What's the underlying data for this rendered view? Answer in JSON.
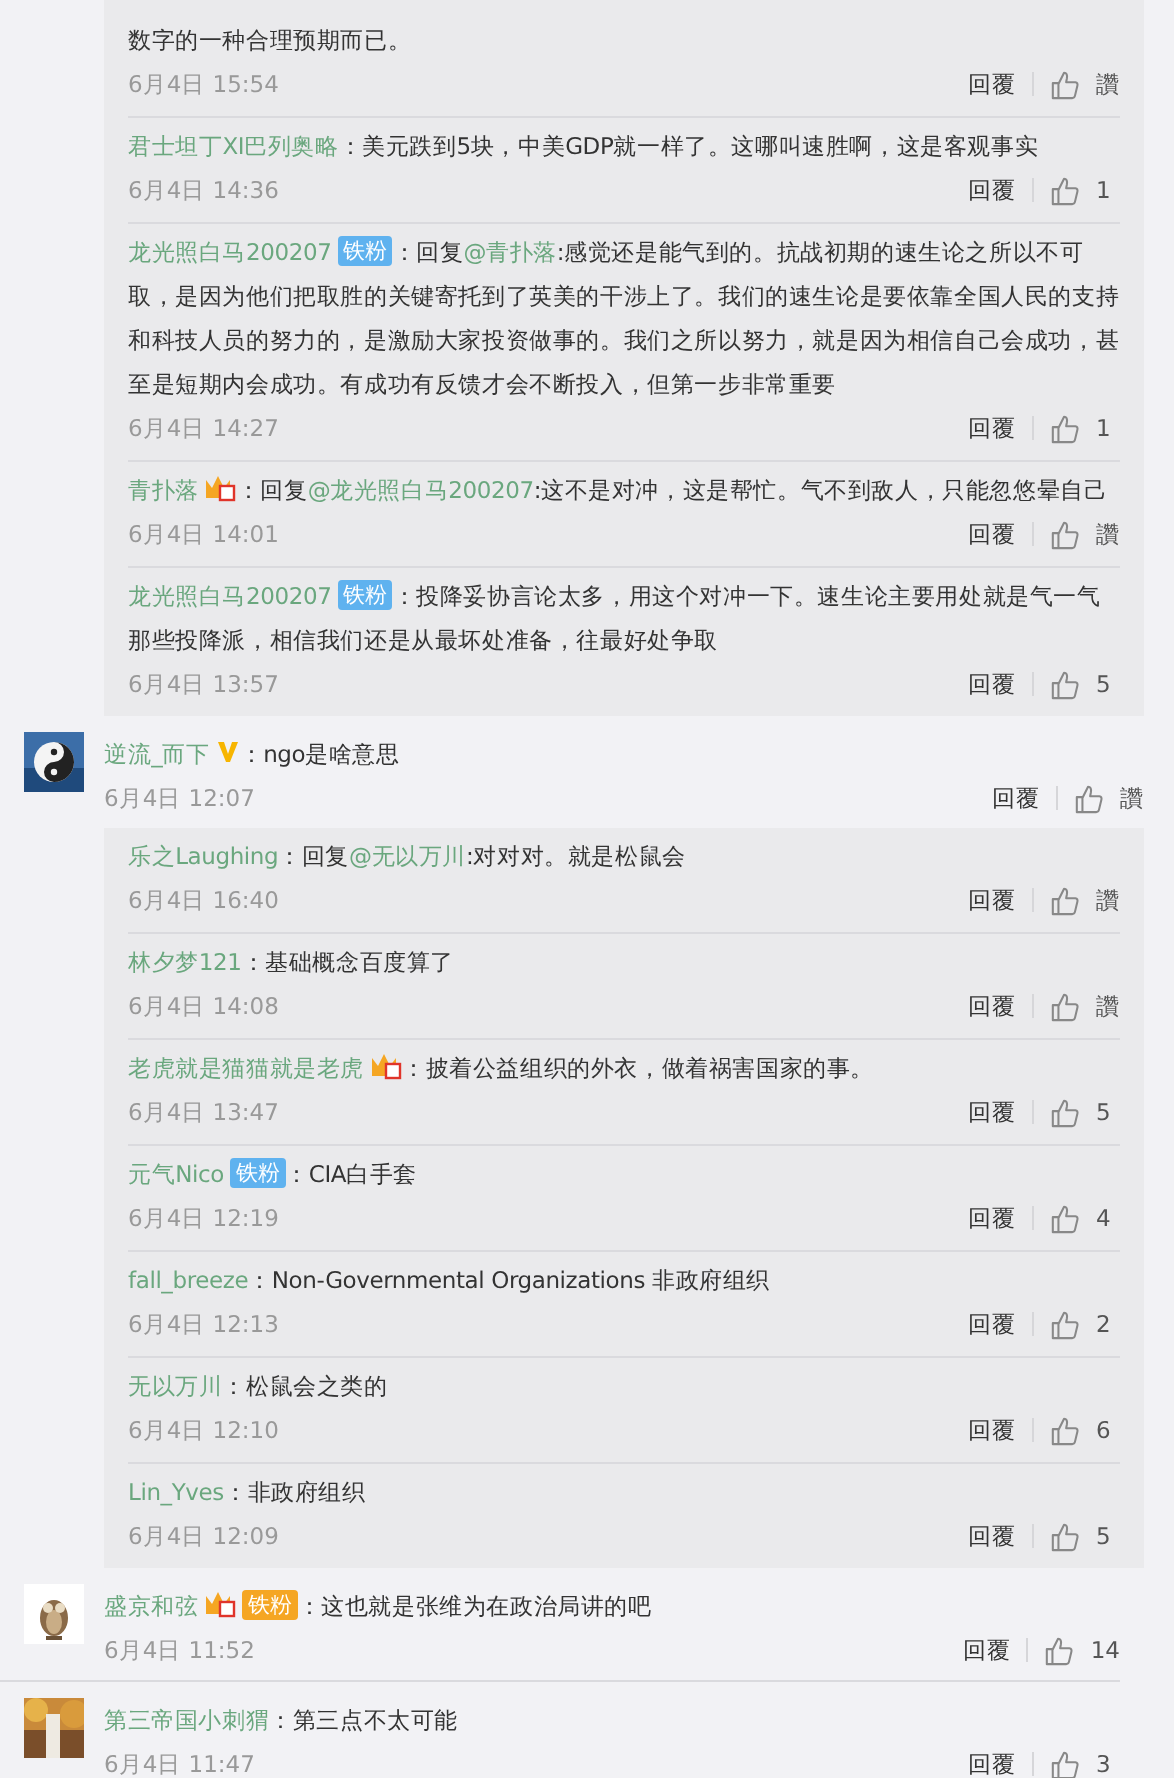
{
  "threads": [
    {
      "kind": "continuation",
      "replies": [
        {
          "body": [
            {
              "text": "数字的一种合理预期而已。"
            }
          ],
          "time": "6月4日 15:54",
          "reply": "回覆",
          "likes": "讚"
        },
        {
          "user": "君士坦丁XI巴列奥略",
          "body": [
            {
              "text": "：美元跌到5块，中美GDP就一样了。这哪叫速胜啊，这是客观事实"
            }
          ],
          "time": "6月4日 14:36",
          "reply": "回覆",
          "likes": "1"
        },
        {
          "user": "龙光照白马200207",
          "badges": [
            {
              "kind": "fan",
              "label": "铁粉"
            }
          ],
          "body": [
            {
              "text": "：回复"
            },
            {
              "text": "@青扑落",
              "kind": "mention"
            },
            {
              "text": ":感觉还是能气到的。抗战初期的速生论之所以不可取，是因为他们把取胜的关键寄托到了英美的干涉上了。我们的速生论是要依靠全国人民的支持和科技人员的努力的，是激励大家投资做事的。我们之所以努力，就是因为相信自己会成功，甚至是短期内会成功。有成功有反馈才会不断投入，但第一步非常重要"
            }
          ],
          "time": "6月4日 14:27",
          "reply": "回覆",
          "likes": "1"
        },
        {
          "user": "青扑落",
          "badges": [
            {
              "kind": "crown"
            }
          ],
          "body": [
            {
              "text": "：回复"
            },
            {
              "text": "@龙光照白马200207",
              "kind": "mention"
            },
            {
              "text": ":这不是对冲，这是帮忙。气不到敌人，只能忽悠晕自己"
            }
          ],
          "time": "6月4日 14:01",
          "reply": "回覆",
          "likes": "讚"
        },
        {
          "user": "龙光照白马200207",
          "badges": [
            {
              "kind": "fan",
              "label": "铁粉"
            }
          ],
          "body": [
            {
              "text": "：投降妥协言论太多，用这个对冲一下。速生论主要用处就是气一气那些投降派，相信我们还是从最坏处准备，往最好处争取"
            }
          ],
          "time": "6月4日 13:57",
          "reply": "回覆",
          "likes": "5"
        }
      ]
    },
    {
      "kind": "comment",
      "user": "逆流_而下",
      "badges": [
        {
          "kind": "verified"
        }
      ],
      "body": [
        {
          "text": "：ngo是啥意思"
        }
      ],
      "time": "6月4日 12:07",
      "reply": "回覆",
      "likes": "讚",
      "replies": [
        {
          "user": "乐之Laughing",
          "body": [
            {
              "text": "：回复"
            },
            {
              "text": "@无以万川",
              "kind": "mention"
            },
            {
              "text": ":对对对。就是松鼠会"
            }
          ],
          "time": "6月4日 16:40",
          "reply": "回覆",
          "likes": "讚"
        },
        {
          "user": "林夕梦121",
          "body": [
            {
              "text": "：基础概念百度算了"
            }
          ],
          "time": "6月4日 14:08",
          "reply": "回覆",
          "likes": "讚"
        },
        {
          "user": "老虎就是猫猫就是老虎",
          "badges": [
            {
              "kind": "crown"
            }
          ],
          "body": [
            {
              "text": "：披着公益组织的外衣，做着祸害国家的事。"
            }
          ],
          "time": "6月4日 13:47",
          "reply": "回覆",
          "likes": "5"
        },
        {
          "user": "元气Nico",
          "badges": [
            {
              "kind": "fan",
              "label": "铁粉"
            }
          ],
          "body": [
            {
              "text": "：CIA白手套"
            }
          ],
          "time": "6月4日 12:19",
          "reply": "回覆",
          "likes": "4"
        },
        {
          "user": "fall_breeze",
          "body": [
            {
              "text": "：Non-Governmental Organizations 非政府组织"
            }
          ],
          "time": "6月4日 12:13",
          "reply": "回覆",
          "likes": "2"
        },
        {
          "user": "无以万川",
          "body": [
            {
              "text": "：松鼠会之类的"
            }
          ],
          "time": "6月4日 12:10",
          "reply": "回覆",
          "likes": "6"
        },
        {
          "user": "Lin_Yves",
          "body": [
            {
              "text": "：非政府组织"
            }
          ],
          "time": "6月4日 12:09",
          "reply": "回覆",
          "likes": "5"
        }
      ]
    },
    {
      "kind": "comment",
      "user": "盛京和弦",
      "badges": [
        {
          "kind": "crown"
        },
        {
          "kind": "gold-fan",
          "label": "铁粉"
        }
      ],
      "body": [
        {
          "text": "：这也就是张维为在政治局讲的吧"
        }
      ],
      "time": "6月4日 11:52",
      "reply": "回覆",
      "likes": "14"
    },
    {
      "kind": "comment",
      "user": "第三帝国小刺猬",
      "body": [
        {
          "text": "：第三点不太可能"
        }
      ],
      "time": "6月4日 11:47",
      "reply": "回覆",
      "likes": "3"
    }
  ]
}
